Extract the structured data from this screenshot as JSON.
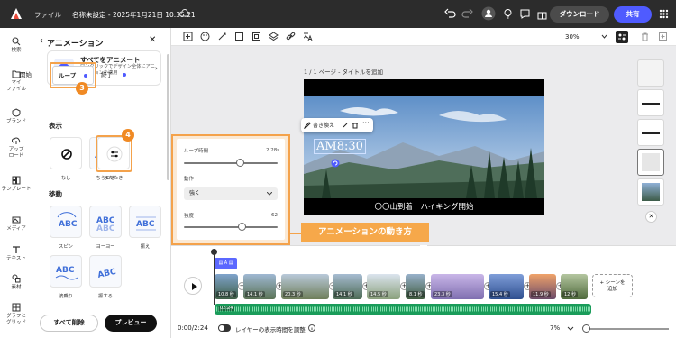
{
  "topbar": {
    "file_menu": "ファイル",
    "doc_title": "名称未設定 - 2025年1月21日 10.35.21",
    "download": "ダウンロード",
    "share": "共有"
  },
  "rail": [
    {
      "label": "検索",
      "icon": "search-icon"
    },
    {
      "label": "マイ\nファイル",
      "icon": "folder-icon"
    },
    {
      "label": "ブランド",
      "icon": "brand-icon"
    },
    {
      "label": "アップ\nロード",
      "icon": "upload-icon"
    },
    {
      "label": "テンプレート",
      "icon": "template-icon"
    },
    {
      "label": "メディア",
      "icon": "media-icon"
    },
    {
      "label": "テキスト",
      "icon": "text-icon"
    },
    {
      "label": "素材",
      "icon": "elements-icon"
    },
    {
      "label": "グラフと\nグリッド",
      "icon": "grid-icon"
    }
  ],
  "panel": {
    "title": "アニメーション",
    "all_anim_title": "すべてをアニメート",
    "all_anim_desc": "ワンクリックでデザイン全体にアニメーションを適用",
    "tabs": [
      "開始",
      "ループ",
      "終了"
    ],
    "section_display": "表示",
    "section_move": "移動",
    "display_items": [
      "なし",
      "ちらつき",
      "またたき"
    ],
    "move_items": [
      "スピン",
      "ヨーヨー",
      "振え",
      "波乗り",
      "振する"
    ],
    "delete_all": "すべて削除",
    "preview": "プレビュー",
    "badges": [
      "3",
      "4"
    ]
  },
  "canvas": {
    "page_label": "1 / 1 ページ - タイトルを追加",
    "time_text": "AM8:30",
    "caption": "〇〇山到着　ハイキング開始",
    "context_menu": [
      "書き換え"
    ],
    "zoom": "30%"
  },
  "loop_settings": {
    "loop_time_label": "ループ時間",
    "loop_time_value": "2.28s",
    "loop_time_level": 0.6,
    "action_label": "動作",
    "action_value": "強く",
    "strength_label": "強度",
    "strength_value": "62",
    "strength_level": 0.62
  },
  "callout": "アニメーションの動き方",
  "timeline": {
    "clips": [
      "10.8 秒",
      "14.1 秒",
      "20.3 秒",
      "14.1 秒",
      "14.5 秒",
      "8.1 秒",
      "23.3 秒",
      "15.4 秒",
      "11.9 秒",
      "12 秒"
    ],
    "add_scene": "+ シーンを\n追加",
    "audio_time": "02:24",
    "current_time": "0:00/2:24",
    "toggle_label": "レイヤーの表示時間を調整",
    "zoom": "7%"
  }
}
